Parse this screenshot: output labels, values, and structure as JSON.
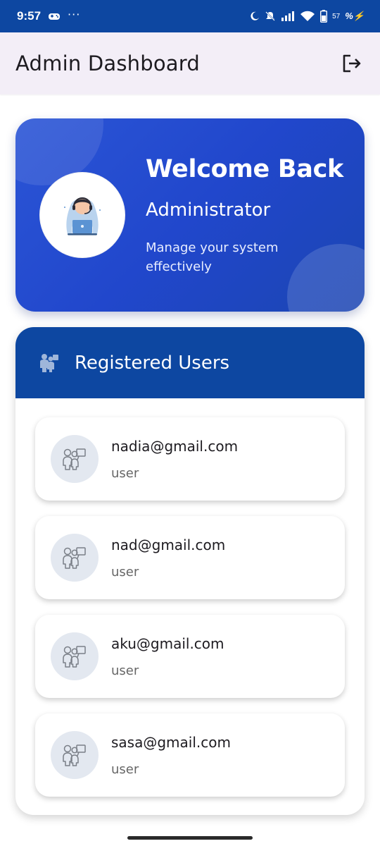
{
  "status_bar": {
    "time": "9:57",
    "dots": "···",
    "battery": "57",
    "charge": "%⚡"
  },
  "app_bar": {
    "title": "Admin Dashboard",
    "logout_icon": "logout-icon"
  },
  "welcome": {
    "title": "Welcome Back",
    "role": "Administrator",
    "description": "Manage your system effectively",
    "avatar_icon": "support-agent-illustration"
  },
  "users_panel": {
    "title": "Registered Users",
    "header_icon": "people-icon",
    "users": [
      {
        "email": "nadia@gmail.com",
        "role": "user"
      },
      {
        "email": "nad@gmail.com",
        "role": "user"
      },
      {
        "email": "aku@gmail.com",
        "role": "user"
      },
      {
        "email": "sasa@gmail.com",
        "role": "user"
      }
    ]
  },
  "colors": {
    "primary": "#0d47a1",
    "card_gradient_start": "#2b55d6",
    "app_bar_bg": "#f3eef7",
    "avatar_bg": "#e3e8f0"
  }
}
